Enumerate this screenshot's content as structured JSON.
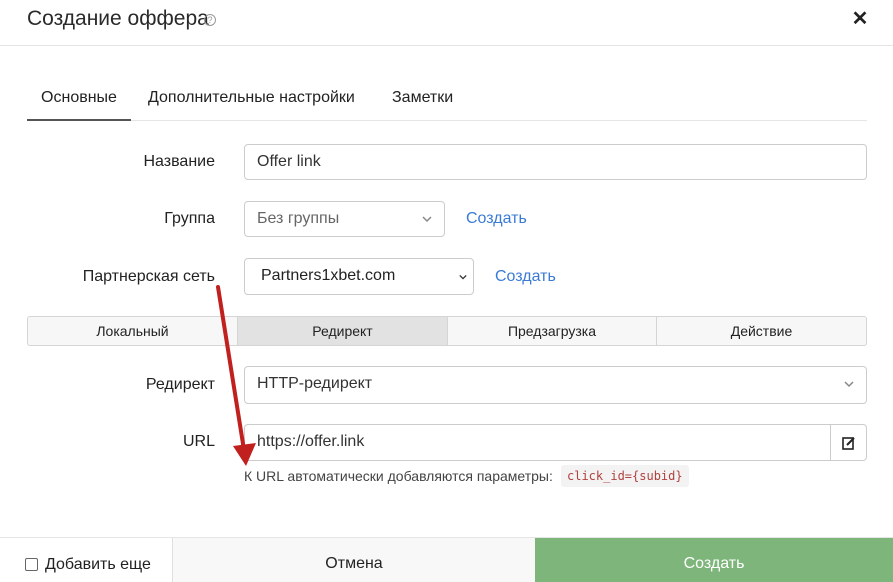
{
  "dialog": {
    "title": "Создание оффера",
    "help_icon": "question-circle-icon",
    "close_icon": "close-icon"
  },
  "tabs": [
    {
      "label": "Основные",
      "active": true
    },
    {
      "label": "Дополнительные настройки",
      "active": false
    },
    {
      "label": "Заметки",
      "active": false
    }
  ],
  "form": {
    "name_label": "Название",
    "name_value": "Offer link",
    "group_label": "Группа",
    "group_value": "Без группы",
    "group_create": "Создать",
    "network_label": "Партнерская сеть",
    "network_value": "Partners1xbet.com",
    "network_create": "Создать",
    "redirect_label": "Редирект",
    "redirect_value": "HTTP-редирект",
    "url_label": "URL",
    "url_value": "https://offer.link",
    "edit_icon": "edit-icon",
    "hint": "К URL автоматически добавляются параметры:",
    "hint_code": "click_id={subid}"
  },
  "segments": [
    {
      "label": "Локальный",
      "active": false
    },
    {
      "label": "Редирект",
      "active": true
    },
    {
      "label": "Предзагрузка",
      "active": false
    },
    {
      "label": "Действие",
      "active": false
    }
  ],
  "footer": {
    "add_more_label": "Добавить еще",
    "add_more_checked": false,
    "cancel_label": "Отмена",
    "create_label": "Создать"
  },
  "colors": {
    "accent_link": "#3a7bd5",
    "create_button": "#7db57b",
    "annotation_arrow": "#c0211f"
  }
}
